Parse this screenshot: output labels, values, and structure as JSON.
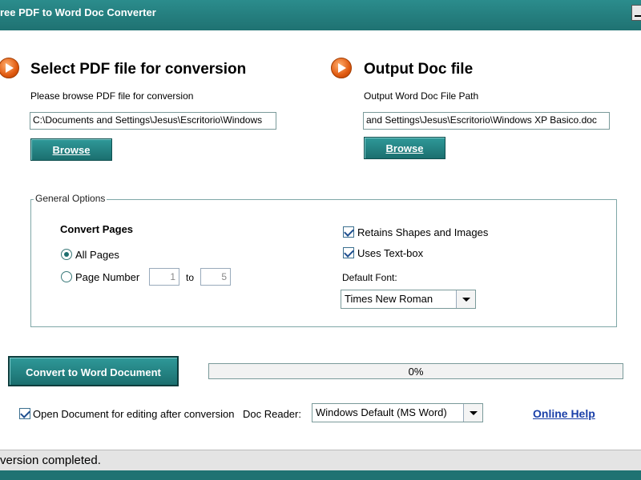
{
  "window": {
    "title": "ree PDF to Word Doc Converter"
  },
  "input_section": {
    "heading": "Select PDF file for conversion",
    "instruction": "Please browse PDF file for conversion",
    "path": "C:\\Documents and Settings\\Jesus\\Escritorio\\Windows",
    "browse_label": "Browse"
  },
  "output_section": {
    "heading": "Output Doc file",
    "instruction": "Output Word Doc File Path",
    "path": "and Settings\\Jesus\\Escritorio\\Windows XP Basico.doc",
    "browse_label": "Browse"
  },
  "general_options": {
    "title": "General Options",
    "convert_pages_label": "Convert Pages",
    "all_pages_label": "All Pages",
    "page_number_label": "Page Number",
    "page_from": "1",
    "to_label": "to",
    "page_to": "5",
    "selected_mode": "All Pages",
    "retains_shapes_label": "Retains Shapes and Images",
    "retains_shapes_checked": true,
    "uses_textbox_label": "Uses Text-box",
    "uses_textbox_checked": true,
    "default_font_label": "Default Font:",
    "default_font_value": "Times New Roman"
  },
  "convert_button_label": "Convert to Word Document",
  "progress": {
    "text": "0%",
    "value": 0
  },
  "open_after_label": "Open Document for editing after conversion",
  "open_after_checked": true,
  "doc_reader_label": "Doc Reader:",
  "doc_reader_value": "Windows Default (MS Word)",
  "online_help_label": "Online Help",
  "status_text": "version completed.",
  "colors": {
    "accent": "#1f7272",
    "link": "#1a3fa8",
    "icon": "#e05a10"
  }
}
